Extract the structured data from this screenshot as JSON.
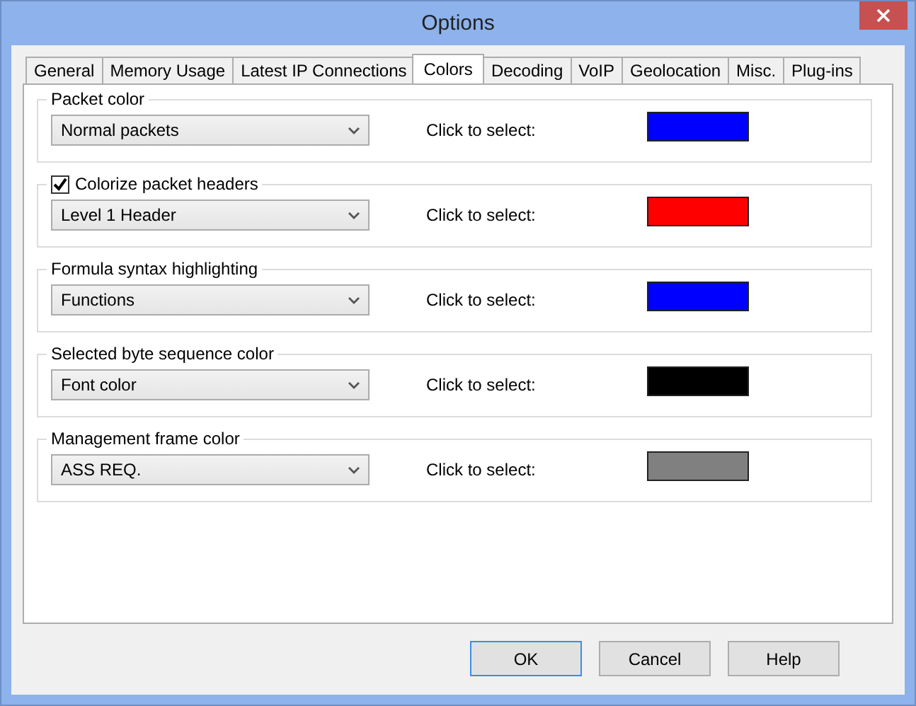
{
  "window": {
    "title": "Options"
  },
  "tabs": [
    {
      "label": "General",
      "selected": false
    },
    {
      "label": "Memory Usage",
      "selected": false
    },
    {
      "label": "Latest IP Connections",
      "selected": false
    },
    {
      "label": "Colors",
      "selected": true
    },
    {
      "label": "Decoding",
      "selected": false
    },
    {
      "label": "VoIP",
      "selected": false
    },
    {
      "label": "Geolocation",
      "selected": false
    },
    {
      "label": "Misc.",
      "selected": false
    },
    {
      "label": "Plug-ins",
      "selected": false
    }
  ],
  "groups": [
    {
      "kind": "plain",
      "title": "Packet color",
      "dropdown": "Normal packets",
      "prompt": "Click to select:",
      "color": "#0000ff"
    },
    {
      "kind": "checkbox",
      "title": "Colorize packet headers",
      "checked": true,
      "dropdown": "Level 1 Header",
      "prompt": "Click to select:",
      "color": "#ff0000"
    },
    {
      "kind": "plain",
      "title": "Formula syntax highlighting",
      "dropdown": "Functions",
      "prompt": "Click to select:",
      "color": "#0000ff"
    },
    {
      "kind": "plain",
      "title": "Selected byte sequence color",
      "dropdown": "Font color",
      "prompt": "Click to select:",
      "color": "#000000"
    },
    {
      "kind": "plain",
      "title": "Management frame color",
      "dropdown": "ASS REQ.",
      "prompt": "Click to select:",
      "color": "#808080"
    }
  ],
  "buttons": [
    {
      "label": "OK",
      "selected": true
    },
    {
      "label": "Cancel",
      "selected": false
    },
    {
      "label": "Help",
      "selected": false
    }
  ]
}
